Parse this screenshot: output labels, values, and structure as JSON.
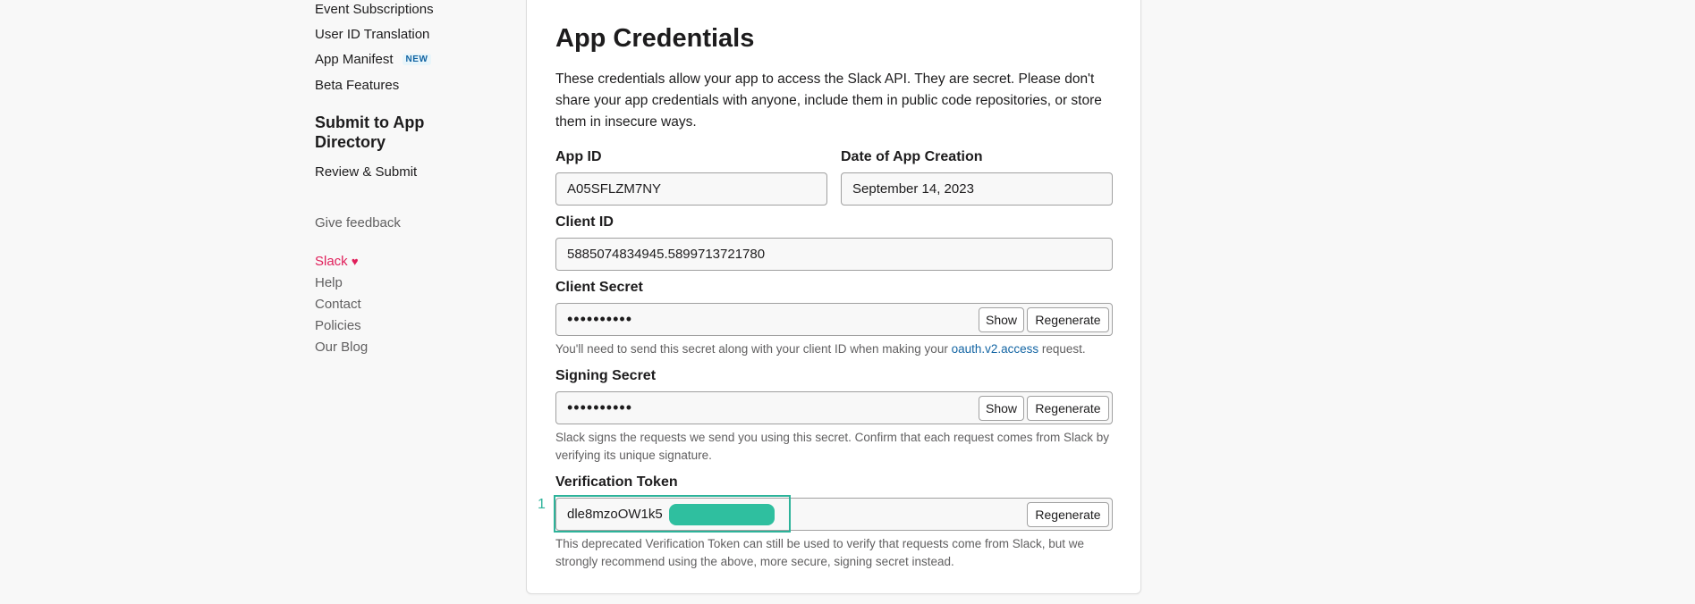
{
  "sidebar": {
    "items": [
      {
        "label": "Event Subscriptions"
      },
      {
        "label": "User ID Translation"
      },
      {
        "label": "App Manifest",
        "badge": "NEW"
      },
      {
        "label": "Beta Features"
      }
    ],
    "section_title": "Submit to App Directory",
    "section_items": [
      {
        "label": "Review & Submit"
      }
    ],
    "give_feedback": "Give feedback",
    "footer": {
      "brand": "Slack",
      "heart": "♥",
      "links": [
        "Help",
        "Contact",
        "Policies",
        "Our Blog"
      ]
    }
  },
  "card": {
    "title": "App Credentials",
    "description": "These credentials allow your app to access the Slack API. They are secret. Please don't share your app credentials with anyone, include them in public code repositories, or store them in insecure ways.",
    "app_id": {
      "label": "App ID",
      "value": "A05SFLZM7NY"
    },
    "date_created": {
      "label": "Date of App Creation",
      "value": "September 14, 2023"
    },
    "client_id": {
      "label": "Client ID",
      "value": "5885074834945.5899713721780"
    },
    "client_secret": {
      "label": "Client Secret",
      "value": "••••••••••",
      "show_label": "Show",
      "regenerate_label": "Regenerate",
      "help_before": "You'll need to send this secret along with your client ID when making your ",
      "help_link": "oauth.v2.access",
      "help_after": " request."
    },
    "signing_secret": {
      "label": "Signing Secret",
      "value": "••••••••••",
      "show_label": "Show",
      "regenerate_label": "Regenerate",
      "help": "Slack signs the requests we send you using this secret. Confirm that each request comes from Slack by verifying its unique signature."
    },
    "verification_token": {
      "label": "Verification Token",
      "value": "dle8mzoOW1k5",
      "regenerate_label": "Regenerate",
      "help": "This deprecated Verification Token can still be used to verify that requests come from Slack, but we strongly recommend using the above, more secure, signing secret instead."
    }
  },
  "annotation": {
    "number": "1"
  },
  "colors": {
    "background": "#f8f8f8",
    "link": "#1264a3",
    "heart": "#e01e5a",
    "annotation": "#2db39a",
    "redaction": "#2fbf9f"
  }
}
